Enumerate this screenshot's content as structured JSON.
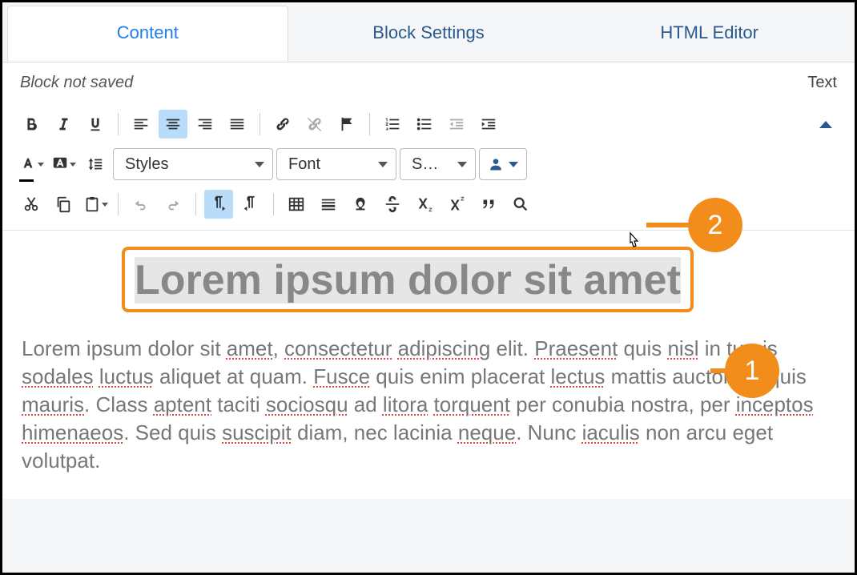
{
  "tabs": {
    "content": "Content",
    "block_settings": "Block Settings",
    "html_editor": "HTML Editor"
  },
  "status": "Block not saved",
  "type_label": "Text",
  "toolbar": {
    "styles": "Styles",
    "font": "Font",
    "size": "S…"
  },
  "callouts": {
    "one": "1",
    "two": "2"
  },
  "content": {
    "heading": "Lorem ipsum dolor sit amet",
    "body_parts": {
      "p1": "Lorem ipsum dolor sit ",
      "s1": "amet",
      "p2": ", ",
      "s2": "consectetur",
      "p3": " ",
      "s3": "adipiscing",
      "p4": " elit. ",
      "s4": "Praesent",
      "p5": " quis ",
      "s5": "nisl",
      "p6": " in turpis ",
      "s6": "sodales",
      "p7": " ",
      "s7": "luctus",
      "p8": " aliquet at quam. ",
      "s8": "Fusce",
      "p9": " quis enim placerat ",
      "s9": "lectus",
      "p10": " mattis auctor vel quis ",
      "s10": "mauris",
      "p11": ". Class ",
      "s11": "aptent",
      "p12": " taciti ",
      "s12": "sociosqu",
      "p13": " ad ",
      "s13": "litora",
      "p14": " ",
      "s14": "torquent",
      "p15": " per conubia nostra, per ",
      "s15": "inceptos",
      "p16": " ",
      "s16": "himenaeos",
      "p17": ". Sed quis ",
      "s17": "suscipit",
      "p18": " diam, nec lacinia ",
      "s18": "neque",
      "p19": ". Nunc ",
      "s19": "iaculis",
      "p20": " non arcu eget volutpat."
    }
  }
}
